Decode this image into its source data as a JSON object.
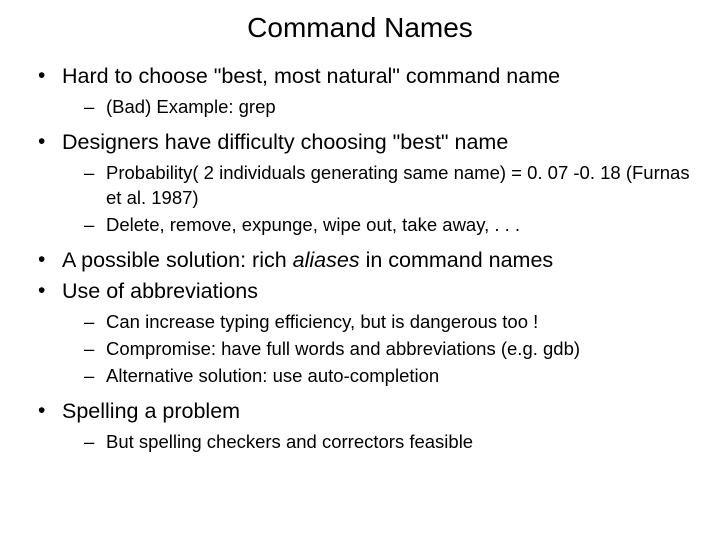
{
  "title": "Command Names",
  "b1": "Hard to choose \"best, most natural\" command name",
  "b1s1": "(Bad) Example: grep",
  "b2": "Designers have difficulty choosing \"best\" name",
  "b2s1": "Probability( 2 individuals generating same name) = 0. 07 -0. 18 (Furnas et al. 1987)",
  "b2s2": "Delete, remove, expunge, wipe out, take away, . . .",
  "b3_pre": "A possible solution: rich ",
  "b3_em": "aliases",
  "b3_post": " in command names",
  "b4": "Use of abbreviations",
  "b4s1": "Can increase typing efficiency, but is dangerous too !",
  "b4s2": "Compromise: have full words and abbreviations (e.g. gdb)",
  "b4s3": "Alternative solution: use auto-completion",
  "b5": "Spelling a problem",
  "b5s1": "But spelling checkers and correctors feasible"
}
